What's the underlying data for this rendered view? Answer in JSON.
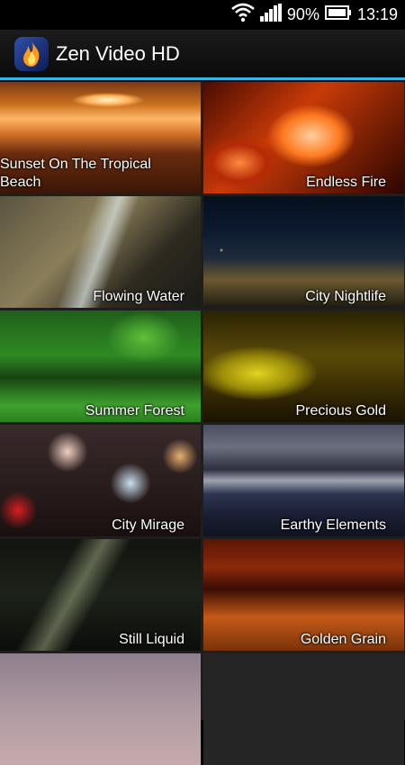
{
  "status_bar": {
    "battery_percent": "90%",
    "time": "13:19",
    "icons": [
      "wifi-icon",
      "signal-icon",
      "battery-icon"
    ]
  },
  "action_bar": {
    "title": "Zen Video HD",
    "icon": "flame-icon",
    "accent_color": "#33b5e5"
  },
  "videos": [
    {
      "title": "Sunset On The Tropical Beach"
    },
    {
      "title": "Endless Fire"
    },
    {
      "title": "Flowing Water"
    },
    {
      "title": "City Nightlife"
    },
    {
      "title": "Summer Forest"
    },
    {
      "title": "Precious Gold"
    },
    {
      "title": "City Mirage"
    },
    {
      "title": "Earthy Elements"
    },
    {
      "title": "Still Liquid"
    },
    {
      "title": "Golden Grain"
    },
    {
      "title": ""
    }
  ]
}
